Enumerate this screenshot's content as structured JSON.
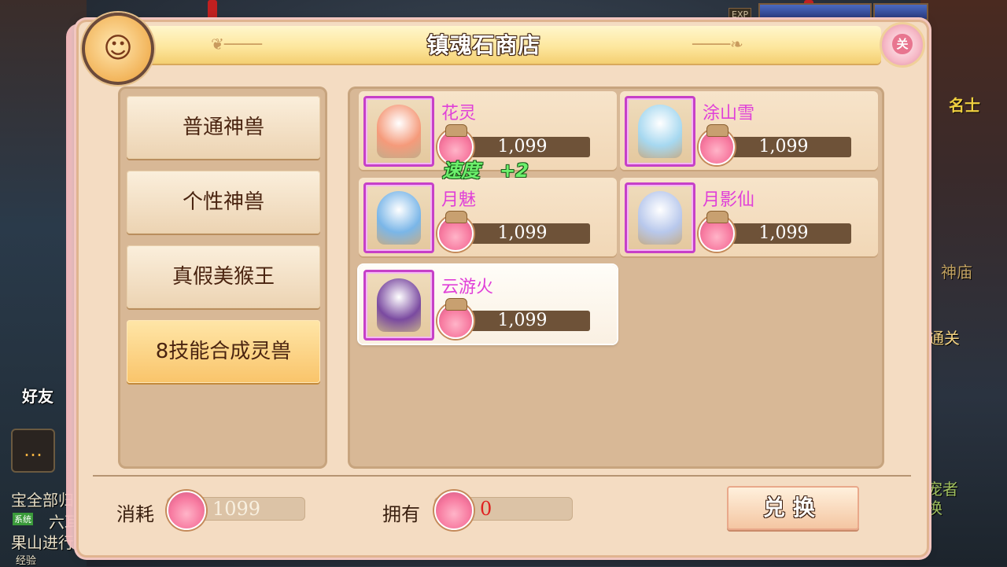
{
  "window": {
    "title": "镇魂石商店",
    "close_label": "关"
  },
  "background": {
    "left_texts": [
      "宝全部归",
      "六耳",
      "果山进行"
    ],
    "left_badge": "系统",
    "friend_label": "好友",
    "right_texts": [
      "神庙",
      "通关",
      "宠者",
      "换"
    ],
    "right_sign": "名士",
    "exp_label": "EXP",
    "bottom_text": "经验"
  },
  "categories": [
    {
      "label": "普通神兽",
      "active": false
    },
    {
      "label": "个性神兽",
      "active": false
    },
    {
      "label": "真假美猴王",
      "active": false
    },
    {
      "label": "8技能合成灵兽",
      "active": true
    }
  ],
  "items": [
    {
      "name": "花灵",
      "price": "1,099",
      "selected": false,
      "color": "#f59a7a"
    },
    {
      "name": "涂山雪",
      "price": "1,099",
      "selected": false,
      "color": "#a6d8f0"
    },
    {
      "name": "月魅",
      "price": "1,099",
      "selected": false,
      "color": "#7ab6e8"
    },
    {
      "name": "月影仙",
      "price": "1,099",
      "selected": false,
      "color": "#b8c8ec"
    },
    {
      "name": "云游火",
      "price": "1,099",
      "selected": true,
      "color": "#7a4aa0"
    }
  ],
  "floating_tag": {
    "text": "速度",
    "value": "+2"
  },
  "footer": {
    "cost_label": "消耗",
    "cost_value": "1099",
    "own_label": "拥有",
    "own_value": "0",
    "exchange_label": "兑换"
  },
  "colors": {
    "accent_name": "#e040d8",
    "own_value": "#e02020",
    "cost_value": "#f8f0e0"
  }
}
